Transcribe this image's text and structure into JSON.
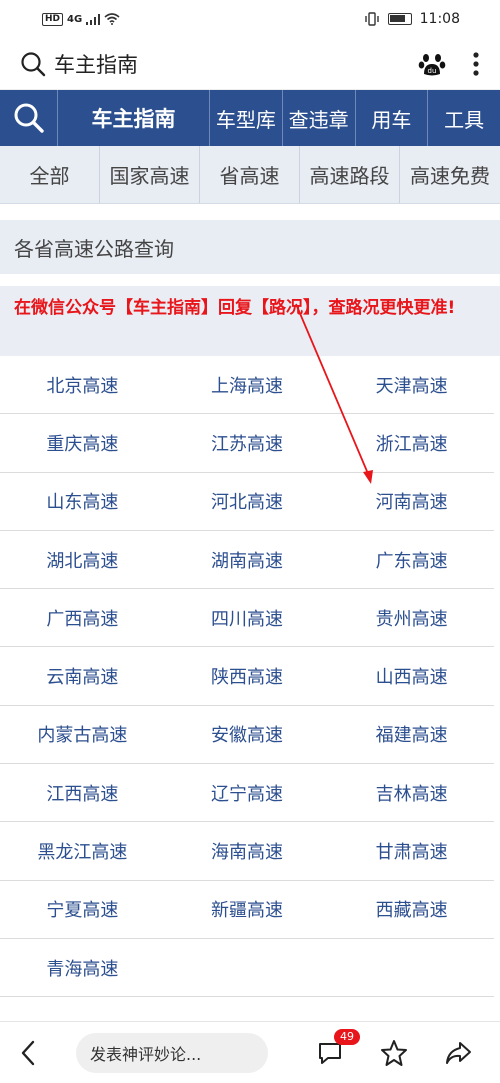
{
  "status_bar": {
    "hd": "HD",
    "network": "4G",
    "time": "11:08",
    "battery_level": 0.8
  },
  "browser": {
    "title": "车主指南"
  },
  "site_nav": {
    "brand": "车主指南",
    "links": [
      "车型库",
      "查违章",
      "用车",
      "工具"
    ]
  },
  "category_tabs": [
    "全部",
    "国家高速",
    "省高速",
    "高速路段",
    "高速免费"
  ],
  "section_title": "各省高速公路查询",
  "notice": "在微信公众号【车主指南】回复【路况】，查路况更快更准!",
  "provinces": [
    [
      "北京高速",
      "上海高速",
      "天津高速"
    ],
    [
      "重庆高速",
      "江苏高速",
      "浙江高速"
    ],
    [
      "山东高速",
      "河北高速",
      "河南高速"
    ],
    [
      "湖北高速",
      "湖南高速",
      "广东高速"
    ],
    [
      "广西高速",
      "四川高速",
      "贵州高速"
    ],
    [
      "云南高速",
      "陕西高速",
      "山西高速"
    ],
    [
      "内蒙古高速",
      "安徽高速",
      "福建高速"
    ],
    [
      "江西高速",
      "辽宁高速",
      "吉林高速"
    ],
    [
      "黑龙江高速",
      "海南高速",
      "甘肃高速"
    ],
    [
      "宁夏高速",
      "新疆高速",
      "西藏高速"
    ],
    [
      "青海高速",
      "",
      ""
    ]
  ],
  "bottom_bar": {
    "comment_placeholder": "发表神评妙论...",
    "comment_count": "49"
  },
  "colors": {
    "nav_blue": "#2c4f8f",
    "notice_red": "#e8161b",
    "tab_bg": "#e8ecf3"
  }
}
